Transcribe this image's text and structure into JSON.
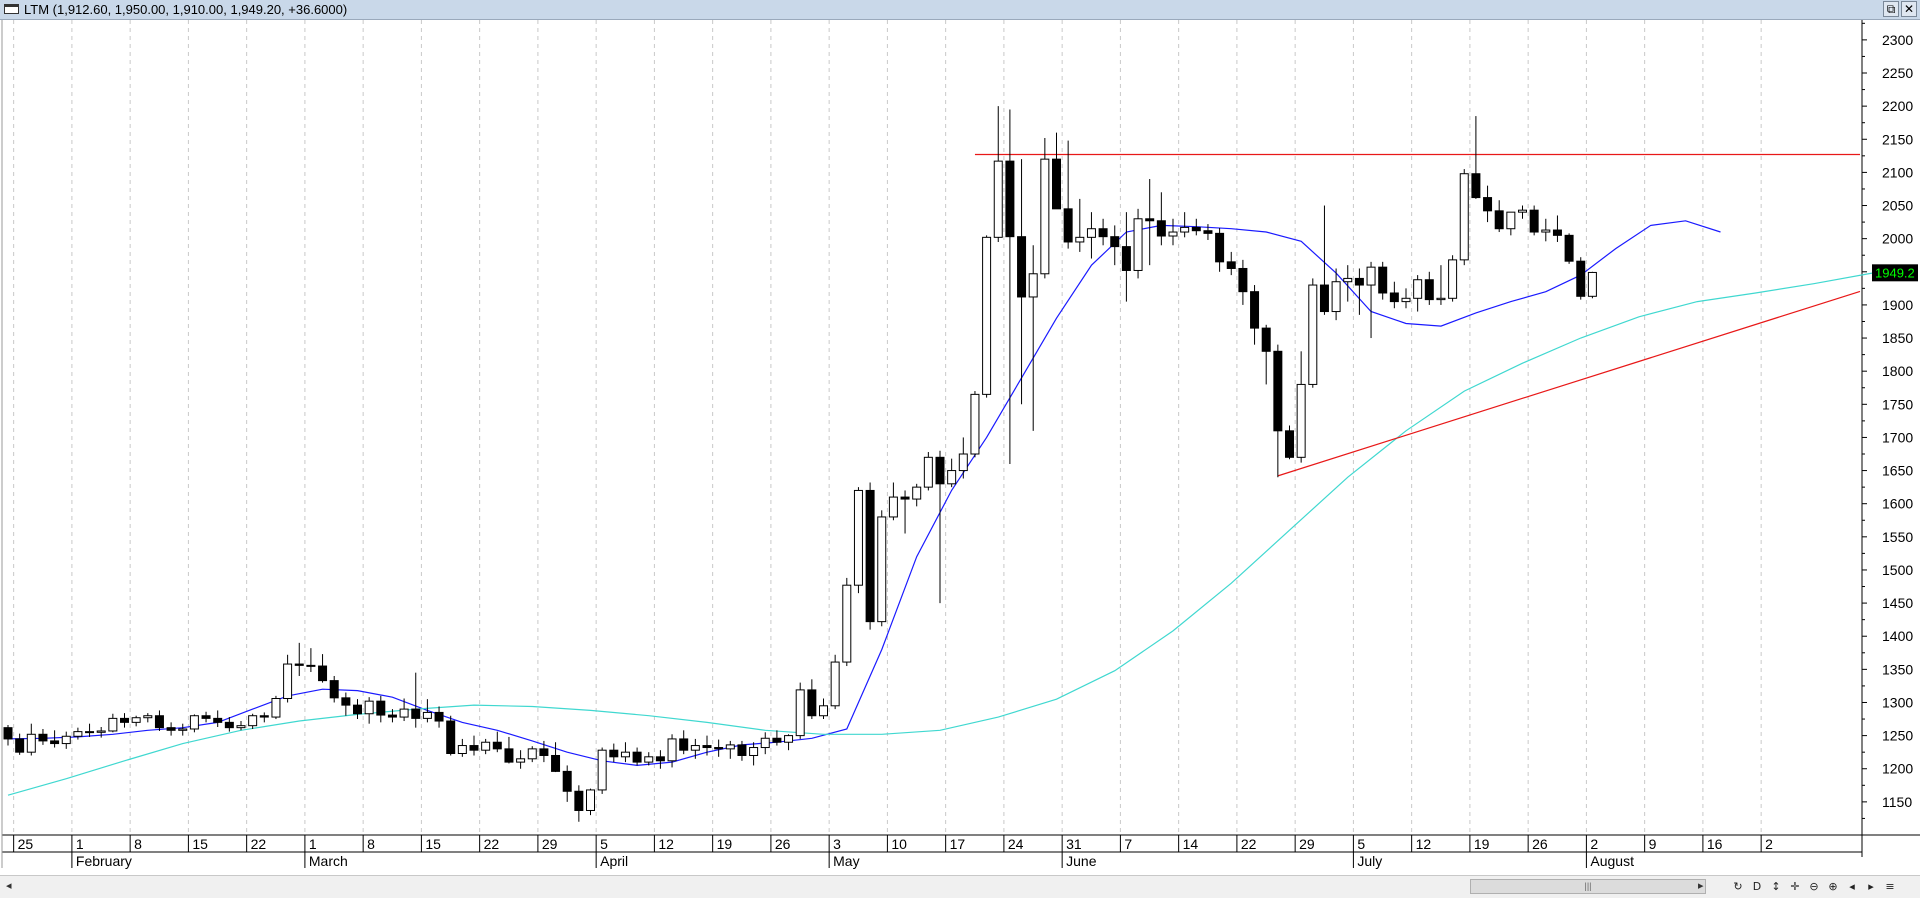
{
  "window": {
    "title": "LTM (1,912.60, 1,950.00, 1,910.00, 1,949.20, +36.6000)",
    "restore_glyph": "⧉",
    "close_glyph": "✕"
  },
  "chart_data": {
    "type": "candlestick",
    "symbol": "LTM",
    "ylim": [
      1100,
      2330
    ],
    "y_ticks": [
      1150,
      1200,
      1250,
      1300,
      1350,
      1400,
      1450,
      1500,
      1550,
      1600,
      1650,
      1700,
      1750,
      1800,
      1850,
      1900,
      1950,
      2000,
      2050,
      2100,
      2150,
      2200,
      2250,
      2300
    ],
    "last_price_label": "1949.2",
    "colors": {
      "ma_fast": "#1a1aff",
      "ma_slow": "#40d8d0",
      "hline": "#e81818",
      "trendline": "#e81818",
      "last_price_bg": "#000000",
      "last_price_fg": "#00ff00"
    },
    "x_day_ticks": [
      "25",
      "1",
      "8",
      "15",
      "22",
      "1",
      "8",
      "15",
      "22",
      "29",
      "5",
      "12",
      "19",
      "26",
      "3",
      "10",
      "17",
      "24",
      "31",
      "7",
      "14",
      "22",
      "29",
      "5",
      "12",
      "19",
      "26",
      "2",
      "9",
      "16",
      "2"
    ],
    "months": [
      "February",
      "March",
      "April",
      "May",
      "June",
      "July",
      "August"
    ],
    "candles": [
      [
        1262,
        1266,
        1235,
        1245
      ],
      [
        1245,
        1253,
        1221,
        1225
      ],
      [
        1225,
        1268,
        1220,
        1252
      ],
      [
        1252,
        1260,
        1236,
        1242
      ],
      [
        1242,
        1258,
        1232,
        1238
      ],
      [
        1238,
        1256,
        1230,
        1249
      ],
      [
        1249,
        1262,
        1244,
        1256
      ],
      [
        1256,
        1268,
        1248,
        1255
      ],
      [
        1255,
        1263,
        1247,
        1257
      ],
      [
        1257,
        1283,
        1255,
        1276
      ],
      [
        1276,
        1284,
        1262,
        1270
      ],
      [
        1270,
        1280,
        1264,
        1277
      ],
      [
        1277,
        1284,
        1270,
        1280
      ],
      [
        1280,
        1288,
        1257,
        1262
      ],
      [
        1262,
        1270,
        1250,
        1258
      ],
      [
        1258,
        1268,
        1250,
        1260
      ],
      [
        1260,
        1282,
        1255,
        1280
      ],
      [
        1280,
        1286,
        1270,
        1276
      ],
      [
        1276,
        1288,
        1263,
        1270
      ],
      [
        1270,
        1278,
        1256,
        1262
      ],
      [
        1262,
        1272,
        1258,
        1265
      ],
      [
        1265,
        1283,
        1260,
        1280
      ],
      [
        1280,
        1285,
        1270,
        1278
      ],
      [
        1278,
        1310,
        1275,
        1306
      ],
      [
        1306,
        1372,
        1300,
        1358
      ],
      [
        1358,
        1390,
        1340,
        1356
      ],
      [
        1356,
        1382,
        1346,
        1355
      ],
      [
        1355,
        1373,
        1330,
        1333
      ],
      [
        1333,
        1340,
        1300,
        1307
      ],
      [
        1307,
        1315,
        1280,
        1296
      ],
      [
        1296,
        1305,
        1275,
        1283
      ],
      [
        1283,
        1308,
        1268,
        1302
      ],
      [
        1302,
        1310,
        1270,
        1281
      ],
      [
        1281,
        1290,
        1270,
        1278
      ],
      [
        1278,
        1306,
        1272,
        1290
      ],
      [
        1290,
        1345,
        1262,
        1276
      ],
      [
        1276,
        1305,
        1270,
        1285
      ],
      [
        1285,
        1294,
        1262,
        1272
      ],
      [
        1272,
        1280,
        1220,
        1223
      ],
      [
        1223,
        1245,
        1218,
        1235
      ],
      [
        1235,
        1250,
        1220,
        1228
      ],
      [
        1228,
        1245,
        1222,
        1240
      ],
      [
        1240,
        1256,
        1225,
        1230
      ],
      [
        1230,
        1248,
        1208,
        1210
      ],
      [
        1210,
        1228,
        1200,
        1215
      ],
      [
        1215,
        1234,
        1210,
        1230
      ],
      [
        1230,
        1242,
        1210,
        1220
      ],
      [
        1220,
        1240,
        1195,
        1196
      ],
      [
        1196,
        1205,
        1150,
        1166
      ],
      [
        1166,
        1175,
        1120,
        1137
      ],
      [
        1137,
        1170,
        1130,
        1168
      ],
      [
        1168,
        1232,
        1162,
        1228
      ],
      [
        1228,
        1238,
        1210,
        1218
      ],
      [
        1218,
        1240,
        1210,
        1225
      ],
      [
        1225,
        1232,
        1205,
        1210
      ],
      [
        1210,
        1225,
        1205,
        1218
      ],
      [
        1218,
        1228,
        1200,
        1212
      ],
      [
        1212,
        1252,
        1202,
        1245
      ],
      [
        1245,
        1258,
        1222,
        1228
      ],
      [
        1228,
        1245,
        1215,
        1235
      ],
      [
        1235,
        1250,
        1220,
        1232
      ],
      [
        1232,
        1244,
        1218,
        1230
      ],
      [
        1230,
        1242,
        1215,
        1236
      ],
      [
        1236,
        1242,
        1212,
        1220
      ],
      [
        1220,
        1240,
        1205,
        1232
      ],
      [
        1232,
        1255,
        1222,
        1246
      ],
      [
        1246,
        1258,
        1235,
        1240
      ],
      [
        1240,
        1252,
        1228,
        1250
      ],
      [
        1250,
        1330,
        1245,
        1319
      ],
      [
        1319,
        1335,
        1275,
        1280
      ],
      [
        1280,
        1306,
        1275,
        1295
      ],
      [
        1295,
        1372,
        1290,
        1361
      ],
      [
        1361,
        1488,
        1355,
        1477
      ],
      [
        1477,
        1625,
        1465,
        1620
      ],
      [
        1620,
        1632,
        1410,
        1422
      ],
      [
        1422,
        1590,
        1415,
        1580
      ],
      [
        1580,
        1632,
        1575,
        1610
      ],
      [
        1610,
        1620,
        1555,
        1607
      ],
      [
        1607,
        1630,
        1596,
        1625
      ],
      [
        1625,
        1678,
        1620,
        1670
      ],
      [
        1670,
        1680,
        1450,
        1630
      ],
      [
        1630,
        1668,
        1625,
        1650
      ],
      [
        1650,
        1700,
        1638,
        1675
      ],
      [
        1675,
        1770,
        1670,
        1765
      ],
      [
        1765,
        2005,
        1760,
        2002
      ],
      [
        2002,
        2200,
        1995,
        2117
      ],
      [
        2117,
        2195,
        1660,
        2003
      ],
      [
        2003,
        2120,
        1750,
        1912
      ],
      [
        1912,
        1990,
        1710,
        1947
      ],
      [
        1947,
        2152,
        1940,
        2120
      ],
      [
        2120,
        2160,
        2050,
        2045
      ],
      [
        2045,
        2148,
        1985,
        1995
      ],
      [
        1995,
        2060,
        1980,
        2002
      ],
      [
        2002,
        2040,
        1970,
        2015
      ],
      [
        2015,
        2030,
        1990,
        2003
      ],
      [
        2003,
        2020,
        1960,
        1988
      ],
      [
        1988,
        2040,
        1905,
        1952
      ],
      [
        1952,
        2045,
        1940,
        2030
      ],
      [
        2030,
        2090,
        1960,
        2027
      ],
      [
        2027,
        2070,
        1990,
        2004
      ],
      [
        2004,
        2030,
        1990,
        2010
      ],
      [
        2010,
        2040,
        2002,
        2017
      ],
      [
        2017,
        2030,
        2005,
        2012
      ],
      [
        2012,
        2022,
        1998,
        2008
      ],
      [
        2008,
        2016,
        1950,
        1965
      ],
      [
        1965,
        1980,
        1945,
        1955
      ],
      [
        1955,
        1968,
        1900,
        1920
      ],
      [
        1920,
        1930,
        1840,
        1865
      ],
      [
        1865,
        1870,
        1780,
        1830
      ],
      [
        1830,
        1840,
        1640,
        1710
      ],
      [
        1710,
        1718,
        1667,
        1670
      ],
      [
        1670,
        1830,
        1662,
        1780
      ],
      [
        1780,
        1940,
        1775,
        1930
      ],
      [
        1930,
        2050,
        1885,
        1890
      ],
      [
        1890,
        1955,
        1877,
        1935
      ],
      [
        1935,
        1960,
        1905,
        1940
      ],
      [
        1940,
        1955,
        1885,
        1930
      ],
      [
        1930,
        1965,
        1850,
        1957
      ],
      [
        1957,
        1965,
        1908,
        1918
      ],
      [
        1918,
        1935,
        1895,
        1905
      ],
      [
        1905,
        1925,
        1895,
        1910
      ],
      [
        1910,
        1945,
        1890,
        1938
      ],
      [
        1938,
        1950,
        1900,
        1908
      ],
      [
        1908,
        1960,
        1900,
        1910
      ],
      [
        1910,
        1975,
        1905,
        1968
      ],
      [
        1968,
        2105,
        1960,
        2098
      ],
      [
        2098,
        2185,
        2060,
        2062
      ],
      [
        2062,
        2080,
        2025,
        2042
      ],
      [
        2042,
        2058,
        2010,
        2015
      ],
      [
        2015,
        2040,
        2005,
        2040
      ],
      [
        2040,
        2050,
        2030,
        2043
      ],
      [
        2043,
        2050,
        2005,
        2010
      ],
      [
        2010,
        2030,
        1996,
        2013
      ],
      [
        2013,
        2035,
        1995,
        2005
      ],
      [
        2005,
        2008,
        1962,
        1966
      ],
      [
        1966,
        1972,
        1908,
        1913
      ],
      [
        1913,
        1950,
        1910,
        1949
      ]
    ],
    "ma_fast": [
      1245,
      1246,
      1248,
      1252,
      1258,
      1262,
      1270,
      1290,
      1310,
      1320,
      1318,
      1308,
      1288,
      1270,
      1258,
      1242,
      1225,
      1212,
      1205,
      1210,
      1225,
      1236,
      1240,
      1246,
      1260,
      1380,
      1520,
      1620,
      1700,
      1790,
      1880,
      1960,
      2010,
      2020,
      2018,
      2015,
      2010,
      1996,
      1948,
      1890,
      1872,
      1868,
      1888,
      1905,
      1920,
      1945,
      1985,
      2020,
      2027,
      2010
    ],
    "ma_slow": [
      1160,
      1185,
      1212,
      1238,
      1258,
      1272,
      1282,
      1290,
      1296,
      1294,
      1288,
      1280,
      1270,
      1258,
      1252,
      1252,
      1258,
      1278,
      1305,
      1348,
      1408,
      1480,
      1560,
      1640,
      1710,
      1770,
      1812,
      1850,
      1882,
      1905,
      1918,
      1932,
      1948
    ],
    "hline": {
      "y": 2127,
      "start_candle": 83
    },
    "trendline": {
      "y_start": 1642,
      "y_end": 1876,
      "start_candle": 109,
      "end_candle": 151
    }
  },
  "scrollbar": {
    "left_arrow": "◂",
    "right_arrow": "▸",
    "grip": "|||"
  },
  "toolbar": {
    "buttons": [
      {
        "name": "refresh-icon",
        "glyph": "↻"
      },
      {
        "name": "d-button",
        "glyph": "D"
      },
      {
        "name": "vertical-zoom-icon",
        "glyph": "↕"
      },
      {
        "name": "move-icon",
        "glyph": "✛"
      },
      {
        "name": "zoom-out-icon",
        "glyph": "⊖"
      },
      {
        "name": "zoom-in-icon",
        "glyph": "⊕"
      },
      {
        "name": "scroll-left-icon",
        "glyph": "◂"
      },
      {
        "name": "scroll-right-icon",
        "glyph": "▸"
      },
      {
        "name": "menu-icon",
        "glyph": "≡"
      }
    ]
  }
}
